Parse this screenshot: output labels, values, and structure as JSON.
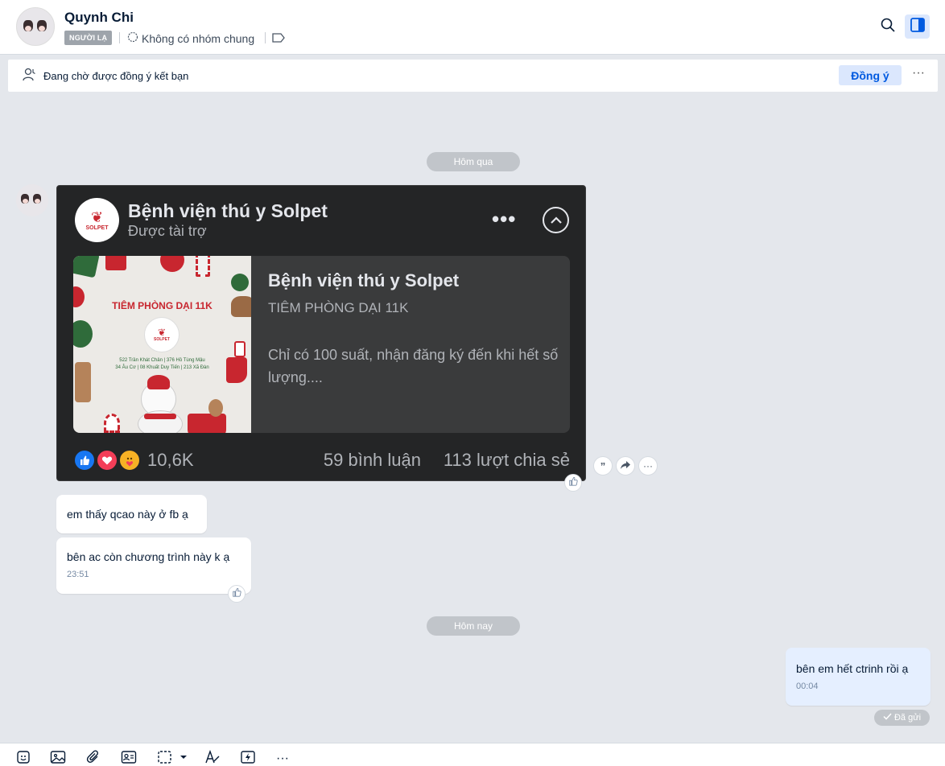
{
  "header": {
    "name": "Quynh Chi",
    "badge": "NGƯỜI LẠ",
    "group_info": "Không có nhóm chung"
  },
  "friend_request": {
    "text": "Đang chờ được đồng ý kết bạn",
    "accept_label": "Đồng ý",
    "more_label": "···"
  },
  "dates": {
    "yesterday": "Hôm qua",
    "today": "Hôm nay"
  },
  "ad_card": {
    "page_name": "Bệnh viện thú y Solpet",
    "sponsored": "Được tài trợ",
    "logo_text": "SOLPET",
    "image_title": "TIÊM PHÒNG DẠI 11K",
    "image_addr_1": "522 Trần Khát Chân | 376 Hồ Tùng Mậu",
    "image_addr_2": "34 Âu Cơ | 08 Khuất Duy Tiến | 213 Xã Đàn",
    "headline": "Bệnh viện thú y Solpet",
    "subline": "TIÊM PHÒNG DẠI 11K",
    "body": "Chỉ có 100 suất, nhận đăng ký đến khi hết số lượng....",
    "reaction_count": "10,6K",
    "comments": "59 bình luận",
    "shares": "113 lượt chia sẻ"
  },
  "messages": {
    "m1": {
      "text": "em thấy qcao này ở fb ạ"
    },
    "m2": {
      "text": "bên ac còn chương trình này k ạ",
      "time": "23:51"
    },
    "m3": {
      "text": "bên em hết ctrinh rồi ạ",
      "time": "00:04",
      "status": "Đã gửi"
    }
  },
  "colors": {
    "accent": "#005ae0",
    "accent_bg": "#dbe7fd",
    "chat_bg": "#e4e7ec",
    "ad_bg": "#242526",
    "my_bubble": "#e5efff"
  },
  "icons": [
    "search-icon",
    "sidebar-toggle-icon",
    "group-icon",
    "tag-icon",
    "user-pending-icon",
    "quote-icon",
    "share-icon",
    "more-icon",
    "like-icon",
    "sticker-icon",
    "image-icon",
    "attachment-icon",
    "contact-card-icon",
    "screenshot-icon",
    "text-format-icon",
    "quick-message-icon"
  ]
}
